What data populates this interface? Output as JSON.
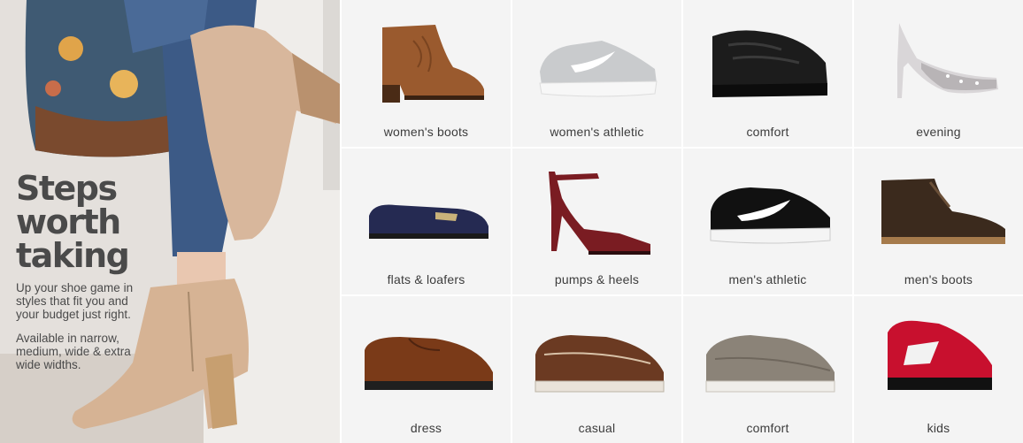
{
  "hero": {
    "headline_line1": "Steps",
    "headline_line2": "worth",
    "headline_line3": "taking",
    "subcopy": "Up your shoe game in styles that fit you and your budget just right.",
    "subcopy2": "Available in narrow, medium, wide & extra wide widths."
  },
  "tiles": [
    {
      "label": "women's boots",
      "icon": "womens-boot-icon"
    },
    {
      "label": "women's athletic",
      "icon": "womens-sneaker-icon"
    },
    {
      "label": "comfort",
      "icon": "clog-icon"
    },
    {
      "label": "evening",
      "icon": "glitter-pump-icon"
    },
    {
      "label": "flats & loafers",
      "icon": "loafer-icon"
    },
    {
      "label": "pumps & heels",
      "icon": "strappy-heel-icon"
    },
    {
      "label": "men's athletic",
      "icon": "mens-sneaker-icon"
    },
    {
      "label": "men's boots",
      "icon": "chukka-boot-icon"
    },
    {
      "label": "dress",
      "icon": "oxford-shoe-icon"
    },
    {
      "label": "casual",
      "icon": "boat-shoe-icon"
    },
    {
      "label": "comfort",
      "icon": "slip-on-icon"
    },
    {
      "label": "kids",
      "icon": "kids-sneaker-icon"
    }
  ],
  "colors": {
    "tile_bg": "#f4f4f4",
    "text": "#3c3c3c",
    "headline": "#4a4a4a"
  }
}
